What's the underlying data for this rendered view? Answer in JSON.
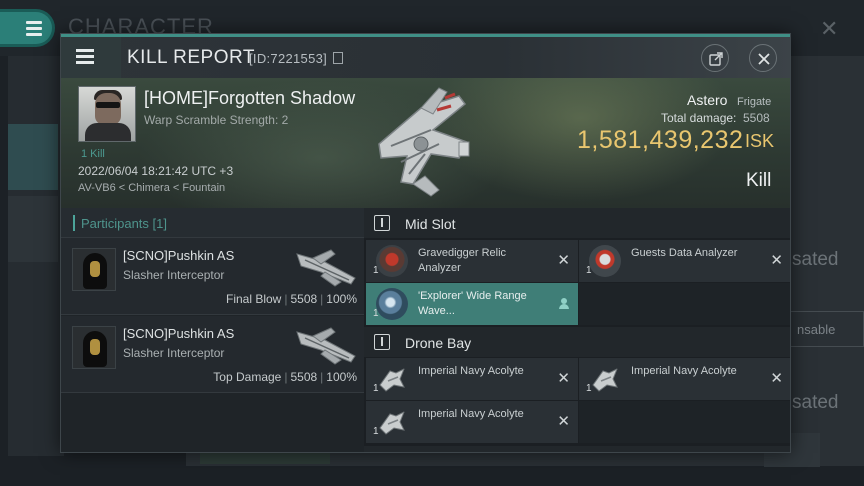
{
  "background": {
    "title": "CHARACTER",
    "faded_right_1": "sated",
    "faded_right_2": "sated",
    "faded_button": "nsable"
  },
  "modal": {
    "title": "KILL REPORT",
    "report_id": "[ID:7221553]"
  },
  "victim": {
    "name": "[HOME]Forgotten Shadow",
    "warp_scramble": "Warp Scramble Strength: 2",
    "kill_count": "1 Kill",
    "datetime": "2022/06/04 18:21:42 UTC +3",
    "location": "AV-VB6 < Chimera < Fountain",
    "ship_name": "Astero",
    "ship_class": "Frigate",
    "total_damage_label": "Total damage:",
    "total_damage": "5508",
    "isk_value": "1,581,439,232",
    "isk_unit": "ISK",
    "result": "Kill"
  },
  "participants": {
    "header": "Participants [1]",
    "rows": [
      {
        "name": "[SCNO]Pushkin AS",
        "ship": "Slasher Interceptor",
        "role": "Final Blow",
        "damage": "5508",
        "percent": "100%"
      },
      {
        "name": "[SCNO]Pushkin AS",
        "ship": "Slasher Interceptor",
        "role": "Top Damage",
        "damage": "5508",
        "percent": "100%"
      }
    ]
  },
  "fitting": {
    "mid_slot_label": "Mid Slot",
    "drone_bay_label": "Drone Bay",
    "mid_items": [
      {
        "qty": "1",
        "name": "Gravedigger Relic Analyzer",
        "status": "destroyed"
      },
      {
        "qty": "1",
        "name": "Guests Data Analyzer",
        "status": "destroyed"
      },
      {
        "qty": "1",
        "name": "'Explorer' Wide Range Wave...",
        "status": "dropped"
      }
    ],
    "drone_items": [
      {
        "qty": "1",
        "name": "Imperial Navy Acolyte",
        "status": "destroyed"
      },
      {
        "qty": "1",
        "name": "Imperial Navy Acolyte",
        "status": "destroyed"
      },
      {
        "qty": "1",
        "name": "Imperial Navy Acolyte",
        "status": "destroyed"
      }
    ]
  },
  "colors": {
    "accent": "#3f8f86",
    "isk_gold": "#e9c66f",
    "highlight_row": "#3f7e77"
  },
  "icons": {
    "menu": "hamburger-icon",
    "copy": "copy-icon",
    "external": "external-link-icon",
    "close": "close-icon",
    "slot": "slot-icon",
    "destroyed": "x-mark-icon",
    "dropped": "person-icon"
  }
}
